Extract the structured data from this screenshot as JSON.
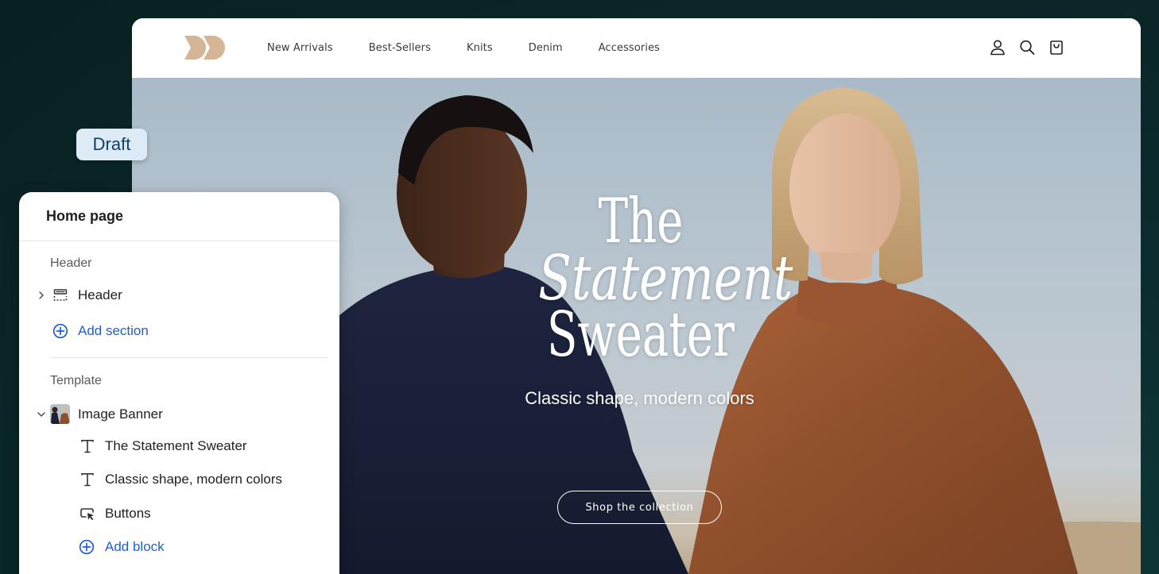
{
  "store": {
    "logo_icon": "brand-logo-icon",
    "nav": [
      "New Arrivals",
      "Best-Sellers",
      "Knits",
      "Denim",
      "Accessories"
    ],
    "icons": [
      "account-icon",
      "search-icon",
      "cart-icon"
    ],
    "hero": {
      "title_line1": "The",
      "title_line2": "Statement",
      "title_line3": "Sweater",
      "subtitle": "Classic shape, modern colors",
      "button": "Shop the collection"
    }
  },
  "badge": {
    "label": "Draft"
  },
  "panel": {
    "title": "Home page",
    "header_group": {
      "label": "Header",
      "items": [
        {
          "label": "Header",
          "icon": "header-layout-icon",
          "expand": "chevron-right-icon"
        }
      ],
      "add": "Add section"
    },
    "template_group": {
      "label": "Template",
      "section": {
        "label": "Image Banner",
        "expand": "chevron-down-icon",
        "thumb": "image-banner-thumbnail"
      },
      "blocks": [
        {
          "label": "The Statement Sweater",
          "icon": "text-icon"
        },
        {
          "label": "Classic shape, modern colors",
          "icon": "text-icon"
        },
        {
          "label": "Buttons",
          "icon": "button-cursor-icon"
        }
      ],
      "add": "Add block"
    }
  },
  "colors": {
    "background": "#0b2b2e",
    "accent_link": "#1d5fd1",
    "badge_bg": "#dcebf6",
    "badge_text": "#123f68",
    "logo": "#d4b596"
  }
}
